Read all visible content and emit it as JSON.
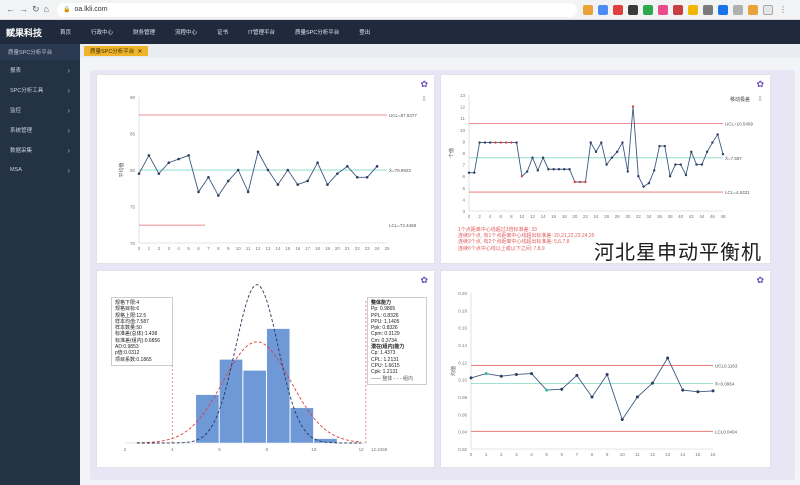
{
  "browser": {
    "url": "oa.lkli.com"
  },
  "app": {
    "brand": "赋果科技"
  },
  "menu": [
    "首页",
    "行政中心",
    "财务管理",
    "流程中心",
    "证书",
    "IT管理平台",
    "质量SPC分析平台",
    "登出"
  ],
  "sidebar": {
    "header": "质量SPC分析平台",
    "items": [
      "报表",
      "SPC分析工具",
      "监控",
      "系统管理",
      "数据采集",
      "MSA"
    ]
  },
  "tabs": [
    {
      "label": "质量SPC分析平台"
    }
  ],
  "panel1": {
    "ylabel": "平均值",
    "ucl_label": "UCL=87.5377",
    "center_label": "X̄=79.9923",
    "lcl_label": "LCL=72.4468",
    "yticks": [
      "90",
      "85",
      "80",
      "75",
      "70"
    ],
    "xticks": [
      "0",
      "1",
      "2",
      "3",
      "4",
      "5",
      "6",
      "7",
      "8",
      "9",
      "10",
      "11",
      "12",
      "13",
      "14",
      "15",
      "16",
      "17",
      "18",
      "19",
      "20",
      "21",
      "22",
      "23",
      "24",
      "25"
    ]
  },
  "panel2": {
    "ylabel": "个值",
    "mr_label": "移动极差",
    "ucl_label": "UCL=10.5409",
    "center_label": "X̄=7.587",
    "lcl_label": "LCL=4.6331",
    "yticks": [
      "13",
      "12",
      "11",
      "10",
      "9",
      "8",
      "7",
      "6",
      "5",
      "4",
      "3"
    ],
    "xticks": [
      "0",
      "2",
      "4",
      "6",
      "8",
      "10",
      "12",
      "14",
      "16",
      "18",
      "20",
      "22",
      "24",
      "26",
      "28",
      "30",
      "32",
      "34",
      "36",
      "38",
      "40",
      "42",
      "44",
      "46",
      "48"
    ],
    "rules": [
      "1个点距离中心线超过3倍标准差: 33",
      "连续9个点, 有1个点距离中心线超出标准差: 20,21,22,23,24,25",
      "连续3个点, 有2个点距离中心线超出标准差: 5,6,7,8",
      "连续6个点中心线以上或以下之间: 7,8,9"
    ]
  },
  "panel3": {
    "stats": [
      "规格下限:4",
      "规格目标:6",
      "规格上限:12.5",
      "样本均值:7.587",
      "样本数量:50",
      "标准差(总体):1.438",
      "标准差(组内):0.6856",
      "AD:0.9853",
      "p值:0.0312",
      "项目系数:0.1865"
    ],
    "capability_title": "整体能力",
    "capability": [
      "Pp: 0.9865",
      "PPL: 0.8326",
      "PPU: 1.1405",
      "Ppk: 0.8326",
      "Cpm: 0.3129",
      "Cm: 0.3734"
    ],
    "potential_title": "潜在(组内)能力",
    "potential": [
      "Cp: 1.4373",
      "CPL: 1.2131",
      "CPU: 1.6615",
      "Cpk: 1.2131"
    ],
    "legend": "—— 整体  - - - 组内",
    "xticks": [
      "2",
      "4",
      "6",
      "8",
      "10",
      "12"
    ],
    "axis_end": "12.2468"
  },
  "panel4": {
    "ylabel": "均值",
    "ucl_label": "UCL0.1163",
    "center_label": "X̄=0.0954",
    "lcl_label": "LCL0.0404",
    "yticks": [
      "0.20",
      "0.18",
      "0.16",
      "0.14",
      "0.12",
      "0.10",
      "0.08",
      "0.06",
      "0.04",
      "0.02"
    ],
    "xticks": [
      "0",
      "1",
      "2",
      "3",
      "4",
      "5",
      "6",
      "7",
      "8",
      "9",
      "10",
      "11",
      "12",
      "13",
      "14",
      "15",
      "16"
    ]
  },
  "watermark": "河北星申动平衡机",
  "chart_data": [
    {
      "type": "line",
      "title": "",
      "ylabel": "平均值",
      "x": [
        0,
        1,
        2,
        3,
        4,
        5,
        6,
        7,
        8,
        9,
        10,
        11,
        12,
        13,
        14,
        15,
        16,
        17,
        18,
        19,
        20,
        21,
        22,
        23,
        24
      ],
      "values": [
        79.5,
        82,
        79.5,
        81,
        81.5,
        82,
        77,
        79,
        76.5,
        78.5,
        80,
        77,
        82.5,
        80,
        78,
        80,
        78,
        78.5,
        81,
        78,
        79.5,
        80.5,
        79,
        79,
        80.5
      ],
      "ucl": 87.5377,
      "center": 79.9923,
      "lcl": 72.4468,
      "ylim": [
        70,
        90
      ]
    },
    {
      "type": "line",
      "ylabel": "个值",
      "x": [
        0,
        1,
        2,
        3,
        4,
        5,
        6,
        7,
        8,
        9,
        10,
        11,
        12,
        13,
        14,
        15,
        16,
        17,
        18,
        19,
        20,
        21,
        22,
        23,
        24,
        25,
        26,
        27,
        28,
        29,
        30,
        31,
        32,
        33,
        34,
        35,
        36,
        37,
        38,
        39,
        40,
        41,
        42,
        43,
        44,
        45,
        46,
        47,
        48,
        49
      ],
      "values": [
        6.3,
        6.3,
        8.9,
        8.9,
        8.9,
        8.9,
        8.9,
        8.9,
        8.9,
        8.9,
        6,
        6.4,
        7.6,
        6.5,
        7.6,
        6.6,
        6.6,
        6.6,
        6.6,
        6.6,
        5.5,
        5.5,
        5.5,
        8.9,
        8.1,
        8.9,
        7,
        7.6,
        8.1,
        8.9,
        6.4,
        12,
        6,
        5.1,
        5.4,
        6.5,
        8.6,
        8.6,
        6,
        7,
        7,
        6.1,
        8.1,
        7,
        7,
        8.1,
        8.9,
        9.6,
        7.9
      ],
      "ucl": 10.5409,
      "center": 7.587,
      "lcl": 4.6331,
      "ylim": [
        3,
        13
      ]
    },
    {
      "type": "bar",
      "title": "",
      "categories": [
        "5-6",
        "6-7",
        "7-8",
        "8-9",
        "9-10",
        "10-11"
      ],
      "values": [
        0.22,
        0.38,
        0.33,
        0.52,
        0.16,
        0.02
      ],
      "xlim": [
        2,
        12.2468
      ]
    },
    {
      "type": "line",
      "ylabel": "均值",
      "x": [
        0,
        1,
        2,
        3,
        4,
        5,
        6,
        7,
        8,
        9,
        10,
        11,
        12,
        13,
        14,
        15,
        16
      ],
      "values": [
        0.102,
        0.107,
        0.104,
        0.106,
        0.107,
        0.088,
        0.089,
        0.105,
        0.08,
        0.106,
        0.054,
        0.08,
        0.096,
        0.125,
        0.088,
        0.086,
        0.087
      ],
      "ucl": 0.1163,
      "center": 0.0954,
      "lcl": 0.0404,
      "ylim": [
        0.02,
        0.2
      ]
    }
  ]
}
